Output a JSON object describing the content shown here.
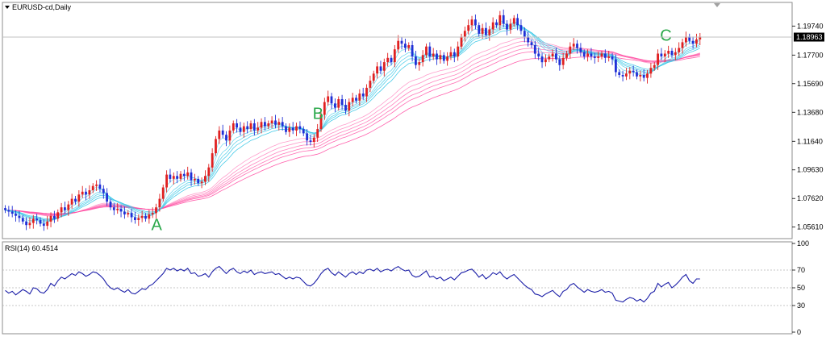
{
  "chart_data": [
    {
      "type": "candlestick",
      "title": "EURUSD-cd,Daily",
      "last_price": "1.18963",
      "ylim": [
        1.048,
        1.214
      ],
      "y_ticks": [
        "1.19740",
        "1.17700",
        "1.15690",
        "1.13680",
        "1.11640",
        "1.09630",
        "1.07620",
        "1.05610"
      ],
      "annotations": [
        {
          "label": "A",
          "index": 43,
          "price": 1.054
        },
        {
          "label": "B",
          "index": 89,
          "price": 1.132
        },
        {
          "label": "C",
          "index": 188,
          "price": 1.187
        }
      ],
      "colors": {
        "up": "#e02020",
        "down": "#1f2fd6",
        "fast_ma": "#36c6e6",
        "slow_ma": "#ff4fa3"
      },
      "close_series": [
        1.068,
        1.067,
        1.0655,
        1.064,
        1.0625,
        1.06,
        1.0575,
        1.059,
        1.062,
        1.061,
        1.0585,
        1.057,
        1.06,
        1.064,
        1.062,
        1.0665,
        1.07,
        1.068,
        1.072,
        1.076,
        1.074,
        1.079,
        1.081,
        1.079,
        1.082,
        1.085,
        1.086,
        1.083,
        1.08,
        1.074,
        1.07,
        1.068,
        1.069,
        1.067,
        1.065,
        1.066,
        1.063,
        1.061,
        1.0625,
        1.064,
        1.062,
        1.065,
        1.066,
        1.07,
        1.076,
        1.084,
        1.093,
        1.09,
        1.092,
        1.09,
        1.0935,
        1.092,
        1.0945,
        1.089,
        1.09,
        1.087,
        1.088,
        1.092,
        1.098,
        1.108,
        1.118,
        1.124,
        1.121,
        1.117,
        1.124,
        1.129,
        1.126,
        1.123,
        1.127,
        1.125,
        1.129,
        1.124,
        1.126,
        1.13,
        1.127,
        1.129,
        1.131,
        1.128,
        1.13,
        1.127,
        1.123,
        1.126,
        1.124,
        1.127,
        1.125,
        1.122,
        1.117,
        1.116,
        1.119,
        1.125,
        1.135,
        1.144,
        1.148,
        1.143,
        1.14,
        1.146,
        1.142,
        1.138,
        1.144,
        1.147,
        1.145,
        1.15,
        1.148,
        1.154,
        1.159,
        1.164,
        1.169,
        1.166,
        1.172,
        1.175,
        1.172,
        1.181,
        1.187,
        1.185,
        1.182,
        1.184,
        1.176,
        1.17,
        1.172,
        1.177,
        1.183,
        1.176,
        1.178,
        1.174,
        1.177,
        1.173,
        1.176,
        1.179,
        1.176,
        1.183,
        1.19,
        1.194,
        1.198,
        1.202,
        1.198,
        1.192,
        1.196,
        1.191,
        1.195,
        1.2,
        1.198,
        1.205,
        1.199,
        1.195,
        1.199,
        1.203,
        1.198,
        1.194,
        1.19,
        1.186,
        1.184,
        1.178,
        1.176,
        1.172,
        1.174,
        1.176,
        1.178,
        1.174,
        1.17,
        1.175,
        1.178,
        1.183,
        1.185,
        1.182,
        1.179,
        1.176,
        1.178,
        1.176,
        1.175,
        1.176,
        1.178,
        1.175,
        1.176,
        1.174,
        1.165,
        1.163,
        1.162,
        1.164,
        1.166,
        1.165,
        1.162,
        1.163,
        1.161,
        1.164,
        1.168,
        1.17,
        1.178,
        1.176,
        1.178,
        1.18,
        1.177,
        1.179,
        1.182,
        1.186,
        1.19,
        1.187,
        1.185,
        1.188,
        1.19
      ]
    },
    {
      "type": "line",
      "title": "RSI(14) 60.4514",
      "ylim": [
        0,
        100
      ],
      "y_ticks": [
        "100",
        "70",
        "50",
        "30",
        "0"
      ],
      "levels": [
        70,
        50,
        30
      ],
      "line_color": "#1c1fa8",
      "values": [
        47,
        44,
        46,
        42,
        45,
        48,
        46,
        43,
        50,
        49,
        45,
        44,
        48,
        55,
        52,
        58,
        62,
        60,
        63,
        66,
        64,
        68,
        66,
        63,
        65,
        68,
        67,
        64,
        60,
        54,
        50,
        48,
        50,
        47,
        45,
        48,
        44,
        43,
        46,
        49,
        48,
        52,
        54,
        58,
        62,
        66,
        72,
        70,
        72,
        69,
        71,
        69,
        72,
        66,
        67,
        63,
        64,
        66,
        62,
        68,
        72,
        74,
        70,
        66,
        70,
        72,
        68,
        66,
        69,
        67,
        70,
        65,
        67,
        68,
        66,
        67,
        68,
        65,
        66,
        63,
        60,
        62,
        60,
        62,
        61,
        57,
        53,
        52,
        55,
        60,
        66,
        70,
        72,
        67,
        64,
        68,
        65,
        62,
        66,
        68,
        65,
        68,
        66,
        70,
        71,
        69,
        72,
        68,
        70,
        71,
        69,
        72,
        74,
        71,
        69,
        70,
        64,
        62,
        63,
        66,
        69,
        62,
        63,
        60,
        62,
        58,
        60,
        62,
        59,
        63,
        67,
        68,
        70,
        71,
        67,
        62,
        65,
        60,
        63,
        67,
        65,
        68,
        63,
        60,
        63,
        65,
        61,
        57,
        53,
        50,
        48,
        43,
        42,
        40,
        43,
        45,
        47,
        43,
        40,
        46,
        48,
        53,
        55,
        51,
        48,
        45,
        48,
        46,
        45,
        46,
        48,
        45,
        46,
        44,
        36,
        35,
        34,
        37,
        39,
        38,
        35,
        37,
        34,
        38,
        44,
        46,
        55,
        51,
        54,
        56,
        50,
        53,
        57,
        62,
        65,
        58,
        55,
        60,
        60
      ]
    }
  ]
}
